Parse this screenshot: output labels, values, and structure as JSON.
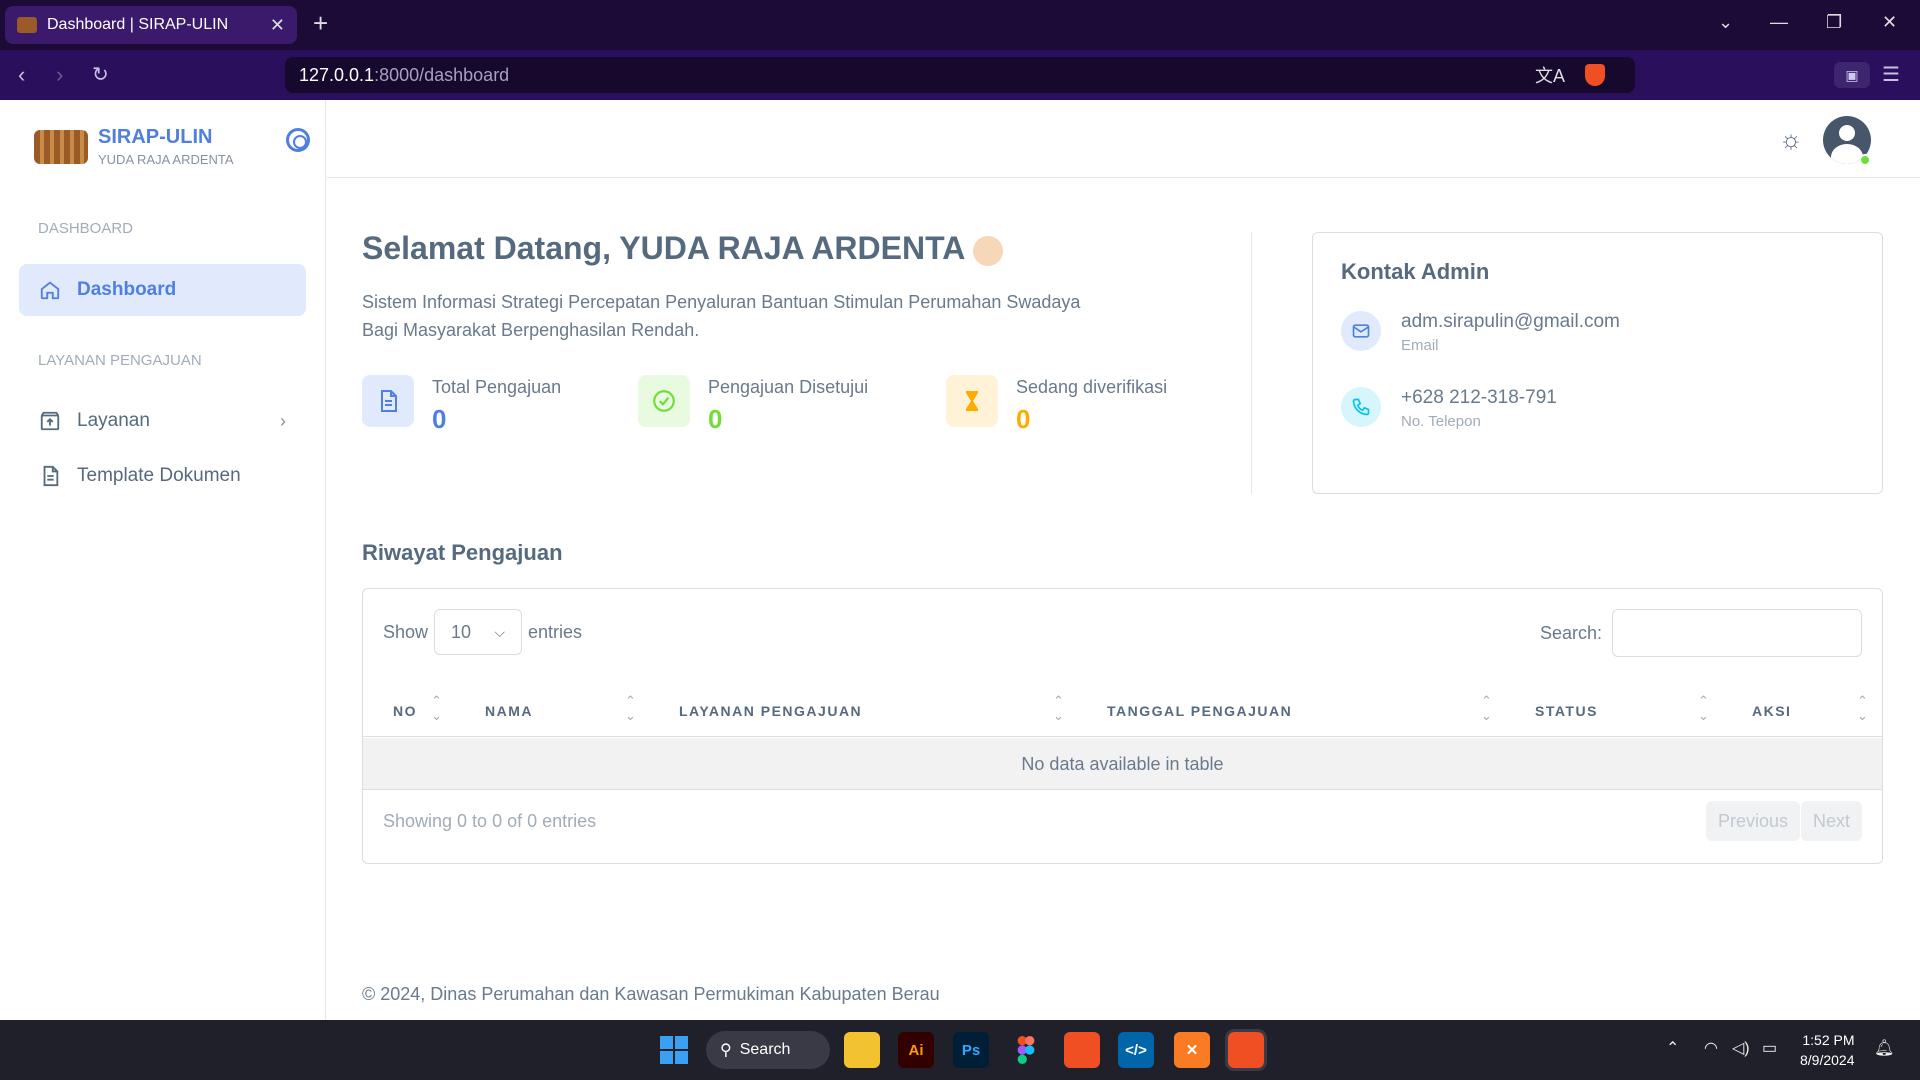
{
  "browser": {
    "tab_title": "Dashboard | SIRAP-ULIN",
    "url_host": "127.0.0.1",
    "url_path": ":8000/dashboard"
  },
  "sidebar": {
    "brand_name": "SIRAP-ULIN",
    "brand_user": "YUDA RAJA ARDENTA",
    "section_dashboard": "DASHBOARD",
    "item_dashboard": "Dashboard",
    "section_layanan": "LAYANAN PENGAJUAN",
    "item_layanan": "Layanan",
    "item_template": "Template Dokumen"
  },
  "main": {
    "welcome": "Selamat Datang, YUDA RAJA ARDENTA",
    "description": "Sistem Informasi Strategi Percepatan Penyaluran Bantuan Stimulan Perumahan Swadaya Bagi Masyarakat Berpenghasilan Rendah.",
    "stats": [
      {
        "label": "Total Pengajuan",
        "value": "0",
        "color": "#4f7fe0"
      },
      {
        "label": "Pengajuan Disetujui",
        "value": "0",
        "color": "#71dd37"
      },
      {
        "label": "Sedang diverifikasi",
        "value": "0",
        "color": "#ffab00"
      }
    ],
    "contact": {
      "title": "Kontak Admin",
      "email": "adm.sirapulin@gmail.com",
      "email_label": "Email",
      "phone": "+628 212-318-791",
      "phone_label": "No. Telepon"
    },
    "history": {
      "title": "Riwayat Pengajuan",
      "show_label": "Show",
      "entries_label": "entries",
      "page_size": "10",
      "search_label": "Search:",
      "columns": [
        "NO",
        "NAMA",
        "LAYANAN PENGAJUAN",
        "TANGGAL PENGAJUAN",
        "STATUS",
        "AKSI"
      ],
      "empty_message": "No data available in table",
      "info": "Showing 0 to 0 of 0 entries",
      "prev_label": "Previous",
      "next_label": "Next"
    },
    "footer": "© 2024, Dinas Perumahan dan Kawasan Permukiman Kabupaten Berau"
  },
  "taskbar": {
    "search_label": "Search",
    "time": "1:52 PM",
    "date": "8/9/2024"
  },
  "colors": {
    "primary": "#4f7fe0",
    "success": "#71dd37",
    "warning": "#ffab00",
    "info": "#03c3ec"
  }
}
